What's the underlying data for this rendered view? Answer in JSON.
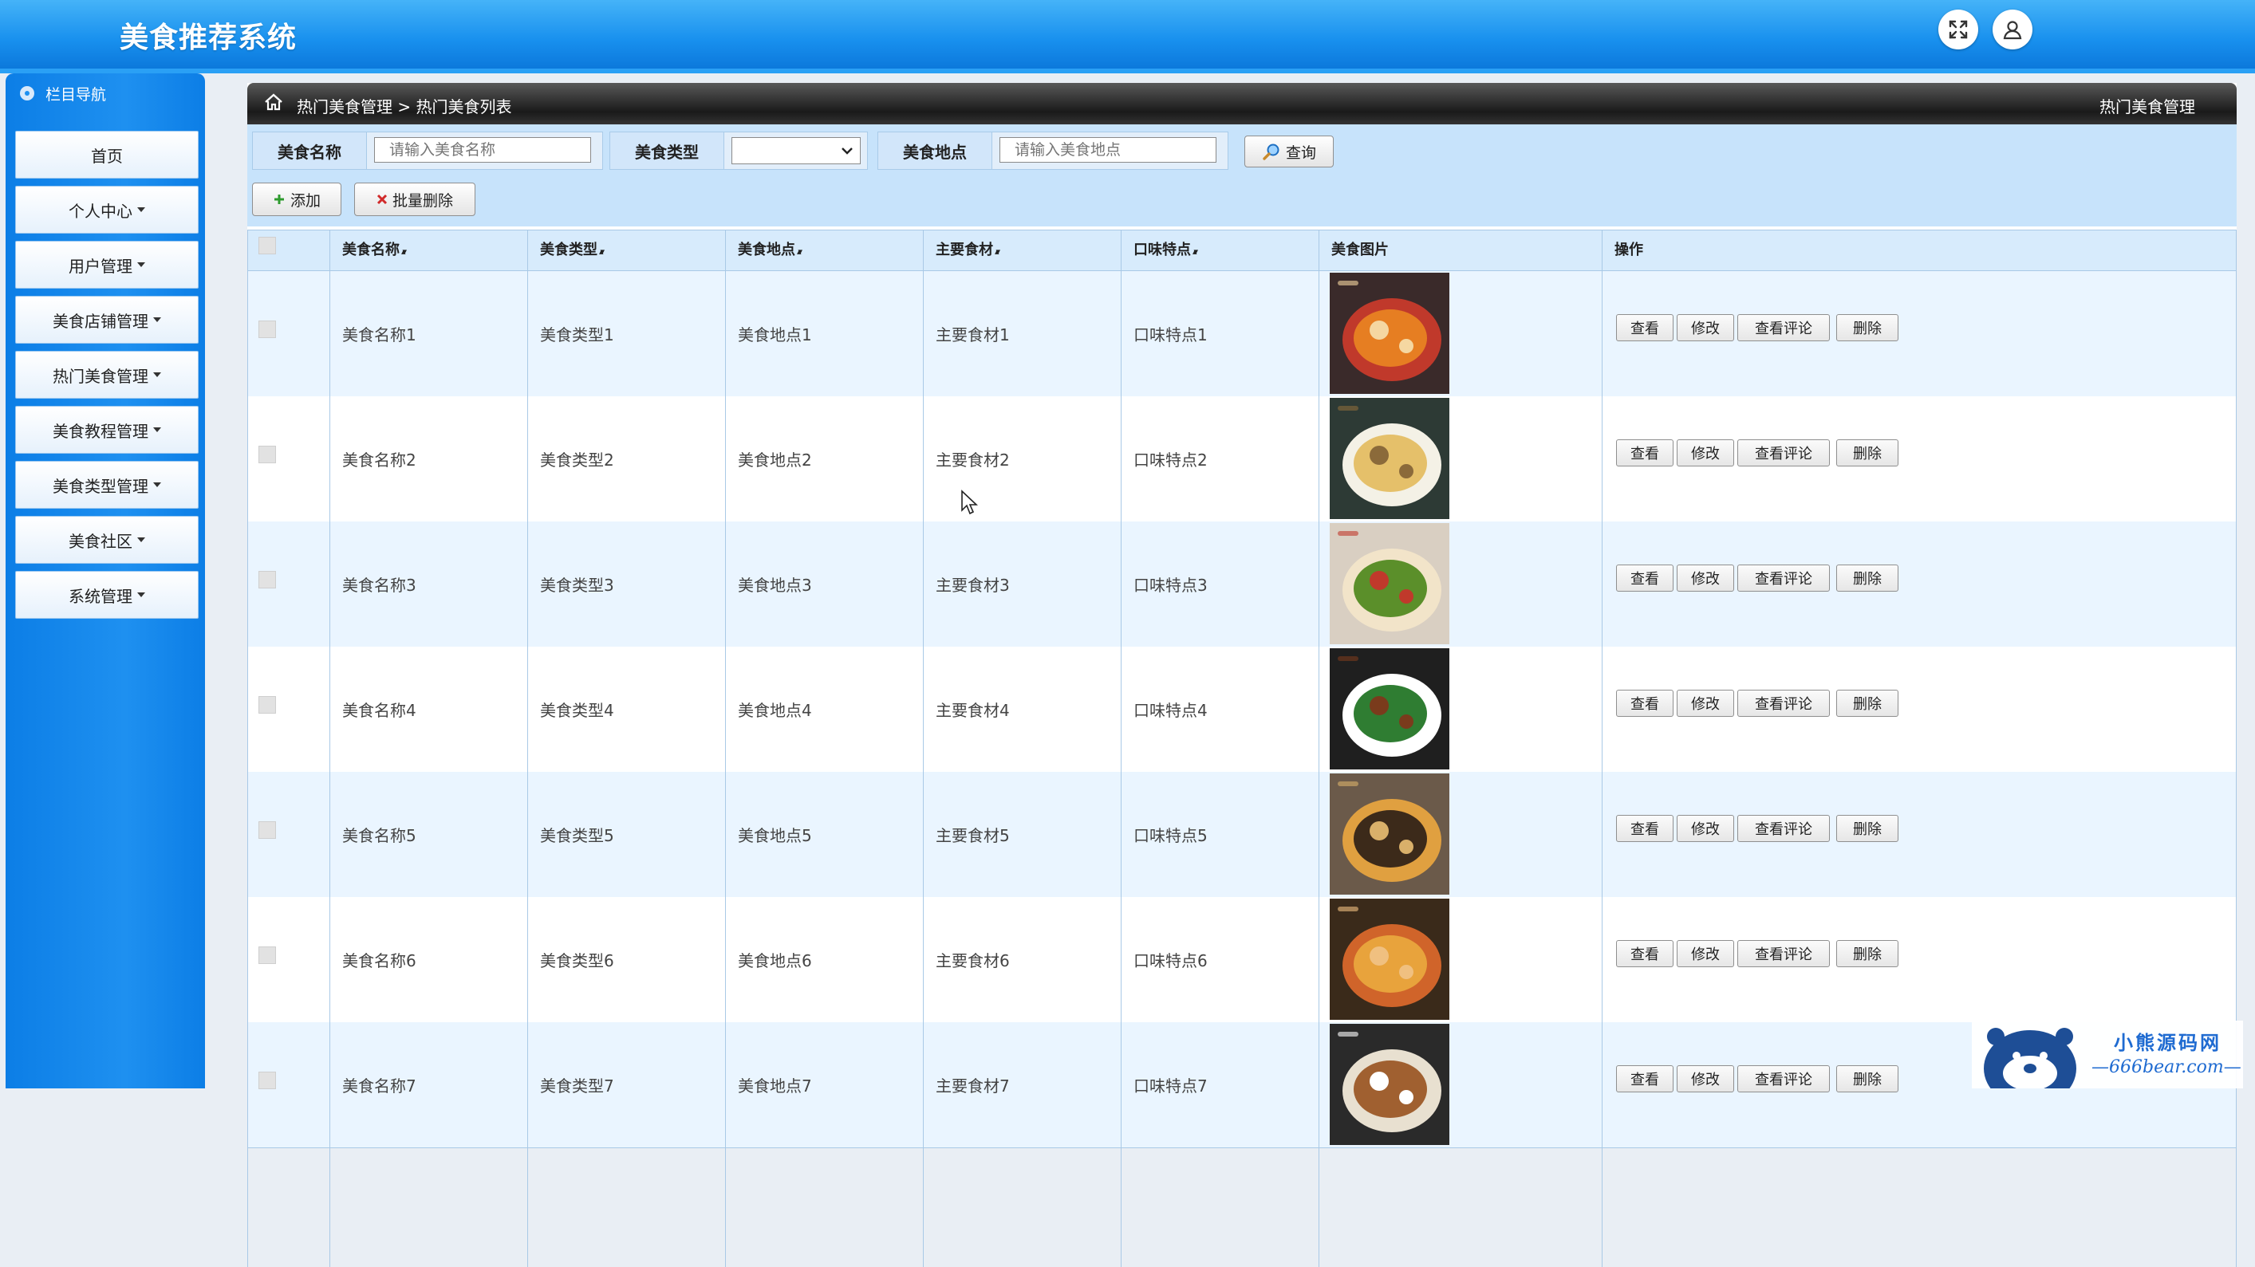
{
  "app": {
    "title": "美食推荐系统"
  },
  "header": {
    "fullscreen_icon": "expand-icon",
    "user_icon": "user-icon"
  },
  "sidebar": {
    "header_label": "栏目导航",
    "items": [
      {
        "label": "首页",
        "has_caret": false
      },
      {
        "label": "个人中心",
        "has_caret": true
      },
      {
        "label": "用户管理",
        "has_caret": true
      },
      {
        "label": "美食店铺管理",
        "has_caret": true
      },
      {
        "label": "热门美食管理",
        "has_caret": true
      },
      {
        "label": "美食教程管理",
        "has_caret": true
      },
      {
        "label": "美食类型管理",
        "has_caret": true
      },
      {
        "label": "美食社区",
        "has_caret": true
      },
      {
        "label": "系统管理",
        "has_caret": true
      }
    ]
  },
  "breadcrumb": {
    "text": "热门美食管理 > 热门美食列表",
    "right": "热门美食管理"
  },
  "filters": {
    "name_label": "美食名称",
    "name_placeholder": "请输入美食名称",
    "type_label": "美食类型",
    "type_value": "",
    "place_label": "美食地点",
    "place_placeholder": "请输入美食地点",
    "search_label": "查询"
  },
  "toolbar": {
    "add_label": "添加",
    "batch_delete_label": "批量删除"
  },
  "table": {
    "columns": [
      "美食名称",
      "美食类型",
      "美食地点",
      "主要食材",
      "口味特点",
      "美食图片",
      "操作"
    ],
    "actions": [
      "查看",
      "修改",
      "查看评论",
      "删除"
    ],
    "rows": [
      {
        "name": "美食名称1",
        "type": "美食类型1",
        "place": "美食地点1",
        "ingredient": "主要食材1",
        "taste": "口味特点1"
      },
      {
        "name": "美食名称2",
        "type": "美食类型2",
        "place": "美食地点2",
        "ingredient": "主要食材2",
        "taste": "口味特点2"
      },
      {
        "name": "美食名称3",
        "type": "美食类型3",
        "place": "美食地点3",
        "ingredient": "主要食材3",
        "taste": "口味特点3"
      },
      {
        "name": "美食名称4",
        "type": "美食类型4",
        "place": "美食地点4",
        "ingredient": "主要食材4",
        "taste": "口味特点4"
      },
      {
        "name": "美食名称5",
        "type": "美食类型5",
        "place": "美食地点5",
        "ingredient": "主要食材5",
        "taste": "口味特点5"
      },
      {
        "name": "美食名称6",
        "type": "美食类型6",
        "place": "美食地点6",
        "ingredient": "主要食材6",
        "taste": "口味特点6"
      },
      {
        "name": "美食名称7",
        "type": "美食类型7",
        "place": "美食地点7",
        "ingredient": "主要食材7",
        "taste": "口味特点7"
      }
    ]
  },
  "watermark": {
    "title": "小熊源码网",
    "url": "—666bear.com—"
  },
  "colors": {
    "header_blue": "#1890ee",
    "sidebar_blue": "#1e90f0",
    "filter_bg": "#c7e3fb",
    "row_alt": "#eaf5ff"
  }
}
